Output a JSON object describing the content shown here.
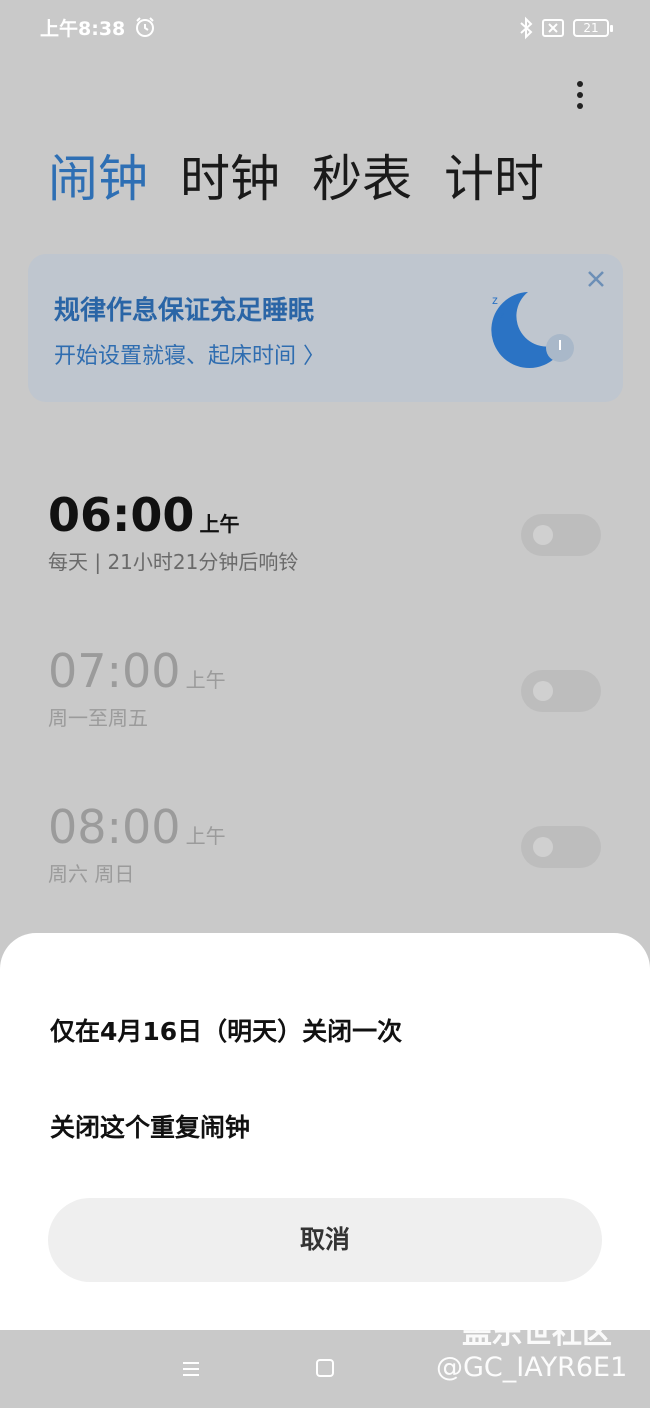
{
  "status_bar": {
    "time": "上午8:38",
    "battery": "21"
  },
  "tabs": [
    {
      "label": "闹钟",
      "active": true
    },
    {
      "label": "时钟",
      "active": false
    },
    {
      "label": "秒表",
      "active": false
    },
    {
      "label": "计时",
      "active": false
    }
  ],
  "banner": {
    "title": "规律作息保证充足睡眠",
    "subtitle": "开始设置就寝、起床时间 〉"
  },
  "alarms": [
    {
      "time": "06:00",
      "ampm": "上午",
      "desc": "每天 | 21小时21分钟后响铃",
      "enabled": false
    },
    {
      "time": "07:00",
      "ampm": "上午",
      "desc": "周一至周五",
      "enabled": false
    },
    {
      "time": "08:00",
      "ampm": "上午",
      "desc": "周六 周日",
      "enabled": false
    }
  ],
  "sheet": {
    "option_once": "仅在4月16日（明天）关闭一次",
    "option_repeat": "关闭这个重复闹钟",
    "cancel": "取消"
  },
  "watermark": {
    "line1": "盖乐世社区",
    "line2": "@GC_IAYR6E1"
  },
  "colors": {
    "accent": "#2e6fb4",
    "dim_background": "#c9c9c9",
    "sheet": "#ffffff"
  },
  "icons": [
    "alarm-status-icon",
    "bluetooth-icon",
    "no-sim-icon",
    "battery-icon",
    "more-vert-icon",
    "close-icon",
    "moon-sleep-icon",
    "menu-icon",
    "home-icon"
  ]
}
